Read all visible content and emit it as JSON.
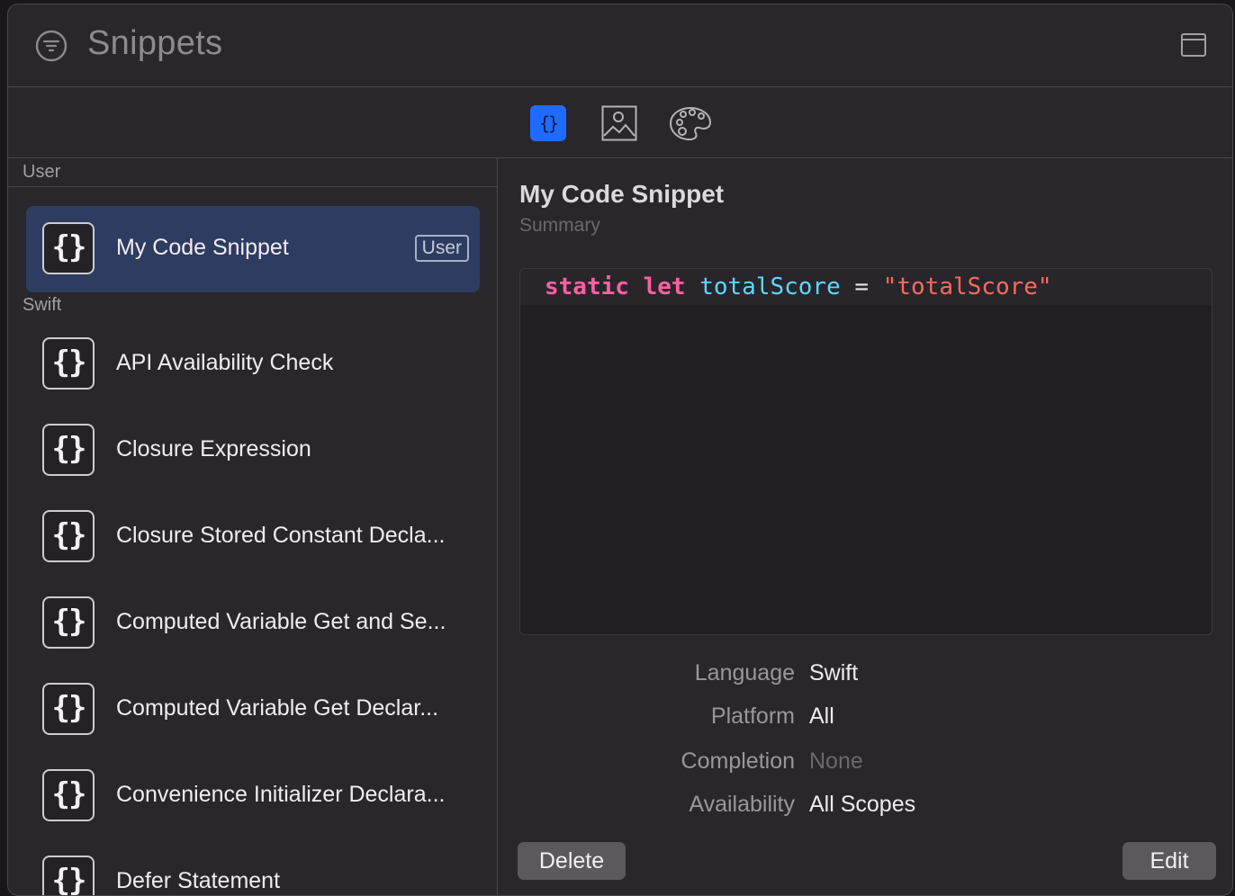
{
  "header": {
    "title": "Snippets",
    "filter_icon": "filter-icon",
    "window_icon": "window-toggle-icon"
  },
  "tabs": [
    {
      "name": "code-snippets",
      "icon": "curly-braces-icon",
      "selected": true
    },
    {
      "name": "media",
      "icon": "image-icon",
      "selected": false
    },
    {
      "name": "colors",
      "icon": "palette-icon",
      "selected": false
    }
  ],
  "sidebar": {
    "sections": [
      {
        "title": "User"
      },
      {
        "title": "Swift"
      }
    ],
    "user_items": [
      {
        "label": "My Code Snippet",
        "badge": "User",
        "icon": "curly-braces-icon",
        "icon_text": "{}"
      }
    ],
    "swift_items": [
      {
        "label": "API Availability Check",
        "icon_text": "{}"
      },
      {
        "label": "Closure Expression",
        "icon_text": "{}"
      },
      {
        "label": "Closure Stored Constant Decla...",
        "icon_text": "{}"
      },
      {
        "label": "Computed Variable Get and Se...",
        "icon_text": "{}"
      },
      {
        "label": "Computed Variable Get Declar...",
        "icon_text": "{}"
      },
      {
        "label": "Convenience Initializer Declara...",
        "icon_text": "{}"
      },
      {
        "label": "Defer Statement",
        "icon_text": "{}"
      }
    ]
  },
  "detail": {
    "title": "My Code Snippet",
    "summary": "Summary",
    "code": {
      "kw1": "static",
      "kw2": "let",
      "identifier": "totalScore",
      "operator": "=",
      "string": "\"totalScore\""
    },
    "properties": [
      {
        "label": "Language",
        "value": "Swift"
      },
      {
        "label": "Platform",
        "value": "All"
      },
      {
        "label": "Completion",
        "value": "None"
      },
      {
        "label": "Availability",
        "value": "All Scopes"
      }
    ],
    "delete_label": "Delete",
    "edit_label": "Edit"
  },
  "colors": {
    "accent": "#1f6bff",
    "selection": "#2f3c61",
    "keyword": "#fc5fa3",
    "identifier": "#5dd8ff",
    "string": "#fc6a5d"
  }
}
